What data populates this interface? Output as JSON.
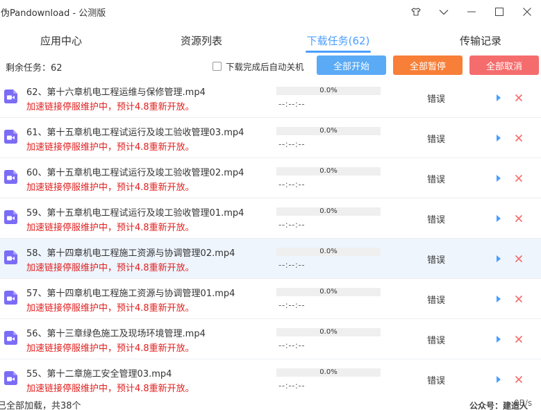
{
  "window": {
    "title": "伪Pandownload - 公测版",
    "controls": [
      "shirt-icon",
      "chevron-down-icon",
      "minimize-icon",
      "maximize-icon",
      "close-icon"
    ]
  },
  "tabs": [
    {
      "label": "应用中心",
      "active": false
    },
    {
      "label": "资源列表",
      "active": false
    },
    {
      "label": "下载任务(62)",
      "active": true
    },
    {
      "label": "传输记录",
      "active": false
    }
  ],
  "toolbar": {
    "remaining_label": "剩余任务：62",
    "auto_shutdown_label": "下载完成后自动关机",
    "auto_shutdown_checked": false,
    "start_all": "全部开始",
    "pause_all": "全部暂停",
    "cancel_all": "全部取消"
  },
  "colors": {
    "accent": "#4a9eff",
    "start": "#5aaaf5",
    "pause": "#f77f37",
    "cancel": "#f56c6c",
    "error_text": "#e02020",
    "file_icon": "#7b6cf6"
  },
  "tasks": [
    {
      "name": "62、第十六章机电工程运维与保修管理.mp4",
      "message": "加速链接停服维护中，预计4.8重新开放。",
      "progress": 0,
      "progress_text": "0.0%",
      "eta": "--:--:--",
      "status": "错误"
    },
    {
      "name": "61、第十五章机电工程试运行及竣工验收管理03.mp4",
      "message": "加速链接停服维护中，预计4.8重新开放。",
      "progress": 0,
      "progress_text": "0.0%",
      "eta": "--:--:--",
      "status": "错误"
    },
    {
      "name": "60、第十五章机电工程试运行及竣工验收管理02.mp4",
      "message": "加速链接停服维护中，预计4.8重新开放。",
      "progress": 0,
      "progress_text": "0.0%",
      "eta": "--:--:--",
      "status": "错误"
    },
    {
      "name": "59、第十五章机电工程试运行及竣工验收管理01.mp4",
      "message": "加速链接停服维护中，预计4.8重新开放。",
      "progress": 0,
      "progress_text": "0.0%",
      "eta": "--:--:--",
      "status": "错误"
    },
    {
      "name": "58、第十四章机电工程施工资源与协调管理02.mp4",
      "message": "加速链接停服维护中，预计4.8重新开放。",
      "progress": 0,
      "progress_text": "0.0%",
      "eta": "--:--:--",
      "status": "错误",
      "highlighted": true
    },
    {
      "name": "57、第十四章机电工程施工资源与协调管理01.mp4",
      "message": "加速链接停服维护中，预计4.8重新开放。",
      "progress": 0,
      "progress_text": "0.0%",
      "eta": "--:--:--",
      "status": "错误"
    },
    {
      "name": "56、第十三章绿色施工及现场环境管理.mp4",
      "message": "加速链接停服维护中，预计4.8重新开放。",
      "progress": 0,
      "progress_text": "0.0%",
      "eta": "--:--:--",
      "status": "错误"
    },
    {
      "name": "55、第十二章施工安全管理03.mp4",
      "message": "加速链接停服维护中，预计4.8重新开放。",
      "progress": 0,
      "progress_text": "0.0%",
      "eta": "--:--:--",
      "status": "错误"
    }
  ],
  "footer": {
    "loaded_text": "已全部加载，共38个",
    "speed": "0B/s",
    "watermark": "公众号：建造人"
  }
}
